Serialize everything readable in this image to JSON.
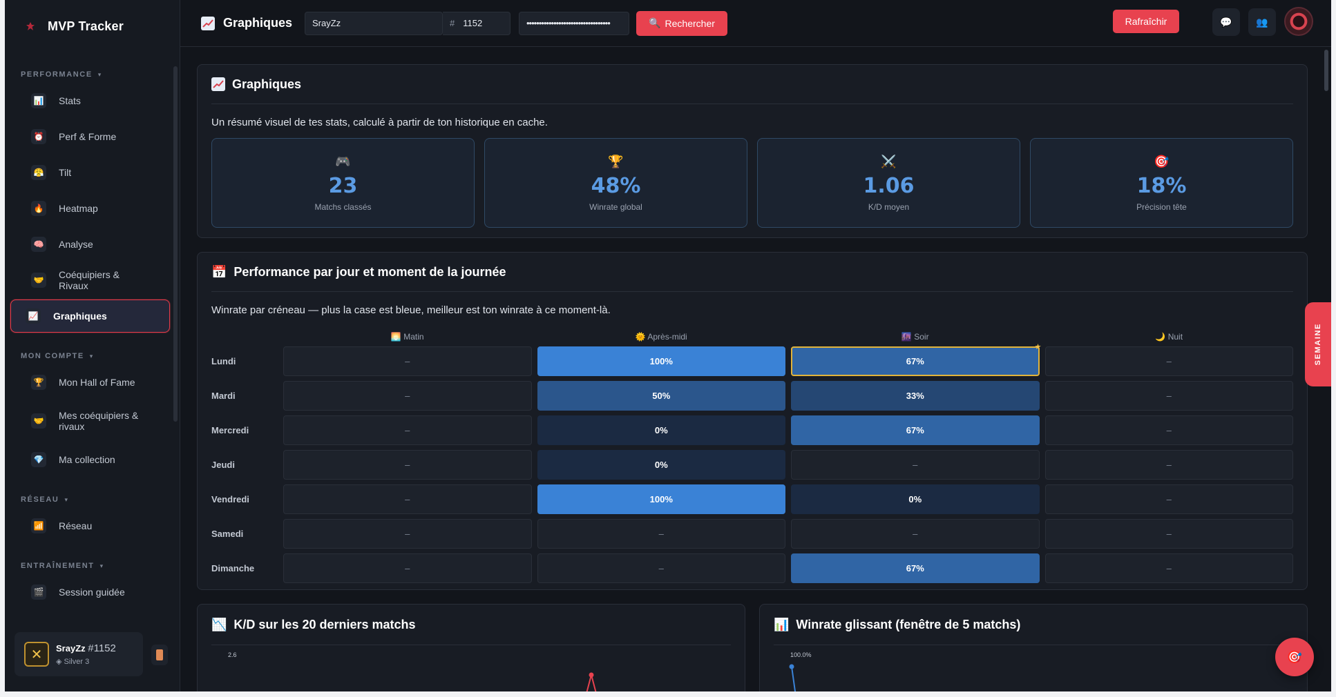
{
  "app": {
    "name": "MVP Tracker"
  },
  "sidebar": {
    "sections": [
      {
        "label": "PERFORMANCE",
        "items": [
          {
            "label": "Stats",
            "icon": "📊"
          },
          {
            "label": "Perf & Forme",
            "icon": "⏰"
          },
          {
            "label": "Tilt",
            "icon": "😤"
          },
          {
            "label": "Heatmap",
            "icon": "🔥"
          },
          {
            "label": "Analyse",
            "icon": "🧠"
          },
          {
            "label": "Coéquipiers & Rivaux",
            "icon": "🤝"
          },
          {
            "label": "Graphiques",
            "icon": "📈",
            "active": true
          }
        ]
      },
      {
        "label": "MON COMPTE",
        "items": [
          {
            "label": "Mon Hall of Fame",
            "icon": "🏆"
          },
          {
            "label": "Mes coéquipiers & rivaux",
            "icon": "🤝"
          },
          {
            "label": "Ma collection",
            "icon": "💎"
          }
        ]
      },
      {
        "label": "RÉSEAU",
        "items": [
          {
            "label": "Réseau",
            "icon": "📶"
          }
        ]
      },
      {
        "label": "ENTRAÎNEMENT",
        "items": [
          {
            "label": "Session guidée",
            "icon": "🎬"
          }
        ]
      }
    ],
    "user": {
      "name": "SrayZz",
      "tag": "#1152",
      "rank": "Silver 3"
    }
  },
  "topbar": {
    "title": "Graphiques",
    "name_value": "SrayZz",
    "hash_symbol": "#",
    "tag_value": "1152",
    "key_value": "••••••••••••••••••••••••••••••••••",
    "search_label": "Rechercher",
    "search_icon": "🔍",
    "refresh_label": "Rafraîchir"
  },
  "overview": {
    "title": "Graphiques",
    "description": "Un résumé visuel de tes stats, calculé à partir de ton historique en cache.",
    "kpis": [
      {
        "icon": "🎮",
        "value": "23",
        "label": "Matchs classés"
      },
      {
        "icon": "🏆",
        "value": "48%",
        "label": "Winrate global"
      },
      {
        "icon": "⚔️",
        "value": "1.06",
        "label": "K/D moyen"
      },
      {
        "icon": "🎯",
        "value": "18%",
        "label": "Précision tête"
      }
    ]
  },
  "heatmap": {
    "title": "Performance par jour et moment de la journée",
    "description": "Winrate par créneau — plus la case est bleue, meilleur est ton winrate à ce moment-là.",
    "columns": [
      {
        "icon": "🌅",
        "label": "Matin"
      },
      {
        "icon": "🌞",
        "label": "Après-midi"
      },
      {
        "icon": "🌆",
        "label": "Soir"
      },
      {
        "icon": "🌙",
        "label": "Nuit"
      }
    ],
    "rows": [
      {
        "day": "Lundi",
        "cells": [
          "–",
          "100%",
          "67%",
          "–"
        ]
      },
      {
        "day": "Mardi",
        "cells": [
          "–",
          "50%",
          "33%",
          "–"
        ]
      },
      {
        "day": "Mercredi",
        "cells": [
          "–",
          "0%",
          "67%",
          "–"
        ]
      },
      {
        "day": "Jeudi",
        "cells": [
          "–",
          "0%",
          "–",
          "–"
        ]
      },
      {
        "day": "Vendredi",
        "cells": [
          "–",
          "100%",
          "0%",
          "–"
        ]
      },
      {
        "day": "Samedi",
        "cells": [
          "–",
          "–",
          "–",
          "–"
        ]
      },
      {
        "day": "Dimanche",
        "cells": [
          "–",
          "–",
          "67%",
          "–"
        ]
      }
    ],
    "best": {
      "row": 0,
      "col": 2
    }
  },
  "kd_panel": {
    "title": "K/D sur les 20 derniers matchs",
    "tick": "2.6",
    "icon": "📉"
  },
  "winrate_panel": {
    "title": "Winrate glissant (fenêtre de 5 matchs)",
    "tick": "100.0%",
    "icon": "📊"
  },
  "side_tab": {
    "label": "SEMAINE"
  },
  "colors": {
    "accent": "#e8424f",
    "kpi_value": "#5b9be3",
    "heat_high": "#3a82d6",
    "heat_low": "#1b2a42"
  }
}
